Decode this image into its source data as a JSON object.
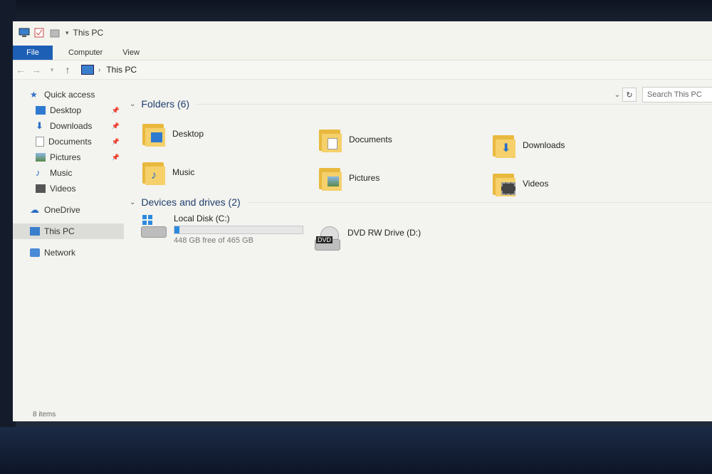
{
  "window": {
    "title": "This PC"
  },
  "ribbon": {
    "tabs": [
      "File",
      "Computer",
      "View"
    ]
  },
  "address": {
    "location": "This PC"
  },
  "search": {
    "placeholder": "Search This PC"
  },
  "sidebar": {
    "quick_access": "Quick access",
    "quick_items": [
      "Desktop",
      "Downloads",
      "Documents",
      "Pictures",
      "Music",
      "Videos"
    ],
    "onedrive": "OneDrive",
    "this_pc": "This PC",
    "network": "Network"
  },
  "folders": {
    "header": "Folders (6)",
    "items": [
      "Desktop",
      "Documents",
      "Downloads",
      "Music",
      "Pictures",
      "Videos"
    ]
  },
  "devices": {
    "header": "Devices and drives (2)",
    "local_disk": {
      "name": "Local Disk (C:)",
      "free_text": "448 GB free of 465 GB",
      "used_fraction": 0.037
    },
    "dvd": {
      "name": "DVD RW Drive (D:)",
      "badge": "DVD"
    }
  },
  "status": {
    "count": "8 items"
  },
  "colors": {
    "accent": "#1d5fb4",
    "folder": "#f5d06b",
    "bar": "#2b8adf"
  }
}
